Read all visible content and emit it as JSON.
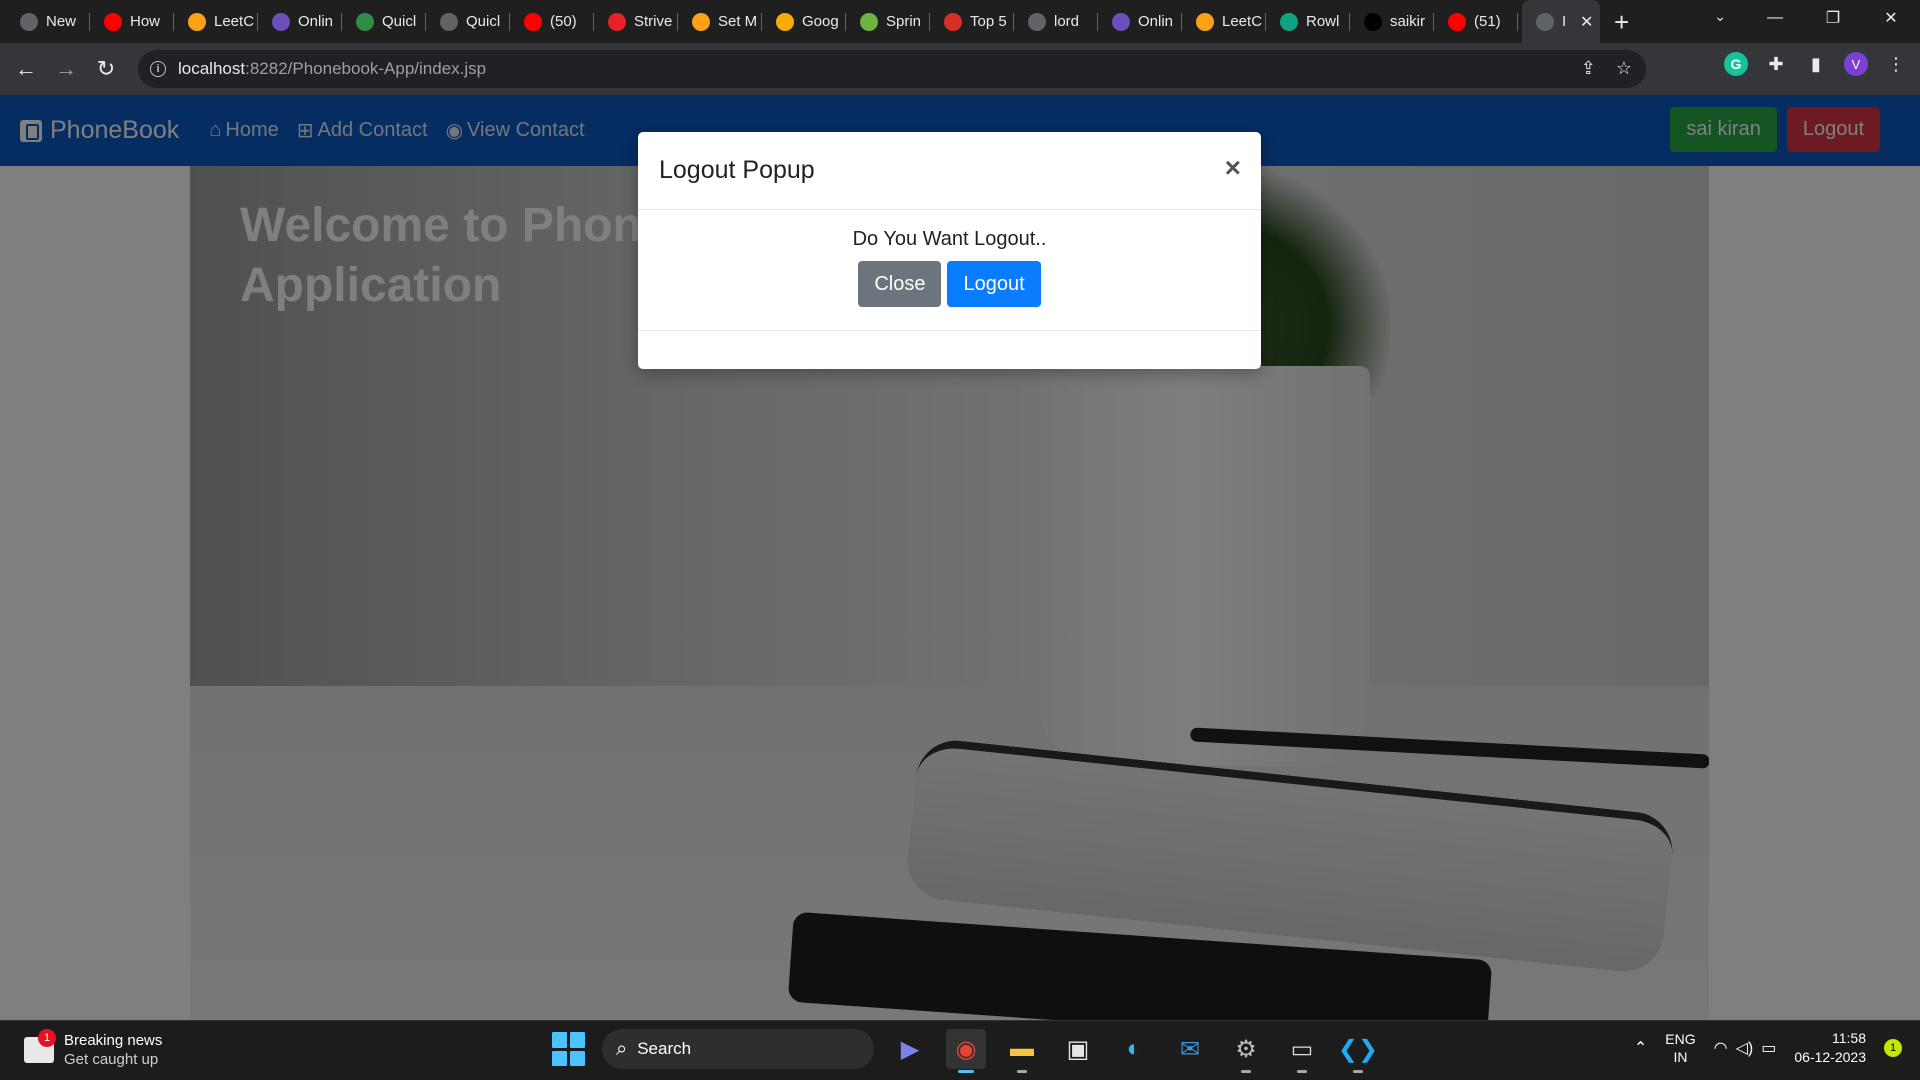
{
  "browser": {
    "tabs": [
      {
        "title": "New",
        "color": "#5f6368"
      },
      {
        "title": "How",
        "color": "#ff0000"
      },
      {
        "title": "LeetC",
        "color": "#ffa116"
      },
      {
        "title": "Onlin",
        "color": "#6b4fbb"
      },
      {
        "title": "Quicl",
        "color": "#2f8d46"
      },
      {
        "title": "Quicl",
        "color": "#5f6368"
      },
      {
        "title": "(50)",
        "color": "#ff0000"
      },
      {
        "title": "Strive",
        "color": "#e8202a"
      },
      {
        "title": "Set M",
        "color": "#ffa116"
      },
      {
        "title": "Goog",
        "color": "#f9ab00"
      },
      {
        "title": "Sprin",
        "color": "#6db33f"
      },
      {
        "title": "Top 5",
        "color": "#d93025"
      },
      {
        "title": "lord",
        "color": "#5f6368"
      },
      {
        "title": "Onlin",
        "color": "#6b4fbb"
      },
      {
        "title": "LeetC",
        "color": "#ffa116"
      },
      {
        "title": "Rowl",
        "color": "#10a37f"
      },
      {
        "title": "saikir",
        "color": "#000000"
      },
      {
        "title": "(51)",
        "color": "#ff0000"
      }
    ],
    "active_tab": {
      "title": "I",
      "close": "✕"
    },
    "new_tab": "+",
    "url_host": "localhost",
    "url_path": ":8282/Phonebook-App/index.jsp",
    "profile_initial": "V"
  },
  "app": {
    "brand": "PhoneBook",
    "nav": {
      "home": "Home",
      "add_contact": "Add Contact",
      "view_contact": "View Contact"
    },
    "user_name": "sai kiran",
    "logout_label": "Logout",
    "hero_title": "Welcome to PhoneBook Application",
    "colors": {
      "navbar": "#0a5bc4",
      "user_btn": "#28a745",
      "logout_btn": "#dc3545",
      "primary": "#0a7cff",
      "secondary": "#6c757d"
    }
  },
  "modal": {
    "title": "Logout Popup",
    "close_x": "×",
    "message": "Do You Want Logout..",
    "close_label": "Close",
    "confirm_label": "Logout"
  },
  "taskbar": {
    "news_title": "Breaking news",
    "news_sub": "Get caught up",
    "news_badge": "1",
    "search_label": "Search",
    "lang_top": "ENG",
    "lang_bottom": "IN",
    "time": "11:58",
    "date": "06-12-2023",
    "notif_count": "1"
  }
}
